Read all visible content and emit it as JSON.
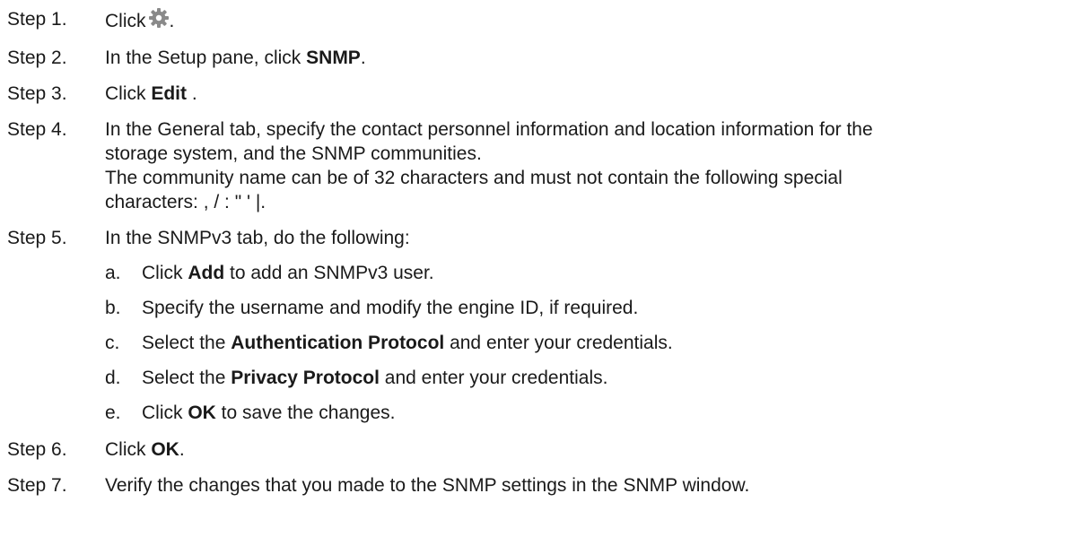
{
  "steps": [
    {
      "label": "Step 1.",
      "pre": "Click",
      "post": "."
    },
    {
      "label": "Step 2.",
      "pre": "In the Setup pane, click ",
      "bold": "SNMP",
      "post": "."
    },
    {
      "label": "Step 3.",
      "pre": "Click ",
      "bold": "Edit",
      "post": " ."
    },
    {
      "label": "Step 4.",
      "line1": "In the General tab, specify the contact personnel information and location information for the",
      "line2": "storage system, and the SNMP communities.",
      "line3": "The community name can be of 32 characters and must not contain the following special",
      "line4": "characters: , / : \" ' |."
    },
    {
      "label": "Step 5.",
      "text": "In the SNMPv3 tab, do the following:",
      "substeps": [
        {
          "letter": "a.",
          "pre": "Click ",
          "bold": "Add",
          "post": " to add an SNMPv3 user."
        },
        {
          "letter": "b.",
          "text": "Specify the username and modify the engine ID, if required."
        },
        {
          "letter": "c.",
          "pre": "Select the ",
          "bold": "Authentication Protocol",
          "post": " and enter your credentials."
        },
        {
          "letter": "d.",
          "pre": "Select the ",
          "bold": "Privacy Protocol",
          "post": " and enter your credentials."
        },
        {
          "letter": "e.",
          "pre": "Click ",
          "bold": "OK",
          "post": " to save the changes."
        }
      ]
    },
    {
      "label": "Step 6.",
      "pre": "Click ",
      "bold": "OK",
      "post": "."
    },
    {
      "label": "Step 7.",
      "text": "Verify the changes that you made to the SNMP settings in the SNMP window."
    }
  ],
  "icons": {
    "step1": "gear-icon"
  },
  "colors": {
    "gear": "#8a8a8a"
  }
}
